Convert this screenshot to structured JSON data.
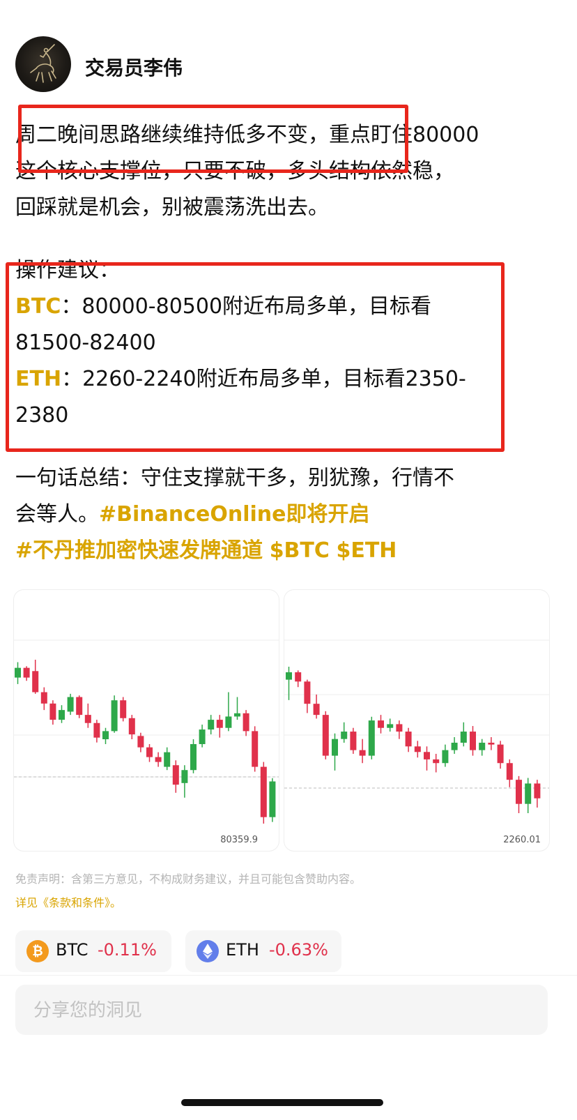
{
  "post": {
    "author": "交易员李伟",
    "para1": [
      "周二晚间思路继续维持低多不变，重点盯住80000",
      "这个核心支撑位，只要不破，多头结构依然稳，",
      "回踩就是机会，别被震荡洗出去。"
    ],
    "ops_title": "操作建议：",
    "btc_label": "BTC",
    "btc_line1": "：80000-80500附近布局多单，目标看",
    "btc_line2": "81500-82400",
    "eth_label": "ETH",
    "eth_line1": "：2260-2240附近布局多单，目标看2350-",
    "eth_line2": "2380",
    "summary_line1": "一句话总结：守住支撑就干多，别犹豫，行情不",
    "summary_line2_text": "会等人。",
    "tag1": "#BinanceOnline即将开启",
    "tag2": "#不丹推加密快速发牌通道",
    "cashtag_btc": "$BTC",
    "cashtag_eth": "$ETH"
  },
  "charts": {
    "btc_price": "80359.9",
    "eth_price": "2260.01"
  },
  "chart_data": [
    {
      "type": "candlestick",
      "price_label": "80359.9",
      "candles": [
        {
          "o": 80,
          "c": 92,
          "h": 99,
          "l": 72
        },
        {
          "o": 92,
          "c": 80,
          "h": 94,
          "l": 76
        },
        {
          "o": 88,
          "c": 62,
          "h": 102,
          "l": 60
        },
        {
          "o": 62,
          "c": 48,
          "h": 68,
          "l": 40
        },
        {
          "o": 48,
          "c": 28,
          "h": 52,
          "l": 22
        },
        {
          "o": 28,
          "c": 40,
          "h": 46,
          "l": 24
        },
        {
          "o": 38,
          "c": 56,
          "h": 60,
          "l": 34
        },
        {
          "o": 56,
          "c": 34,
          "h": 58,
          "l": 30
        },
        {
          "o": 34,
          "c": 24,
          "h": 48,
          "l": 18
        },
        {
          "o": 24,
          "c": 6,
          "h": 28,
          "l": 0
        },
        {
          "o": 4,
          "c": 14,
          "h": 18,
          "l": -2
        },
        {
          "o": 14,
          "c": 52,
          "h": 58,
          "l": 12
        },
        {
          "o": 52,
          "c": 30,
          "h": 56,
          "l": 26
        },
        {
          "o": 30,
          "c": 10,
          "h": 34,
          "l": 4
        },
        {
          "o": 8,
          "c": -6,
          "h": 12,
          "l": -12
        },
        {
          "o": -6,
          "c": -18,
          "h": -2,
          "l": -24
        },
        {
          "o": -18,
          "c": -24,
          "h": -12,
          "l": -30
        },
        {
          "o": -30,
          "c": -12,
          "h": -6,
          "l": -34
        },
        {
          "o": -28,
          "c": -52,
          "h": -22,
          "l": -62
        },
        {
          "o": -50,
          "c": -34,
          "h": -28,
          "l": -68
        },
        {
          "o": -34,
          "c": -2,
          "h": 4,
          "l": -38
        },
        {
          "o": -2,
          "c": 16,
          "h": 22,
          "l": -6
        },
        {
          "o": 16,
          "c": 28,
          "h": 34,
          "l": 10
        },
        {
          "o": 28,
          "c": 18,
          "h": 34,
          "l": 6
        },
        {
          "o": 18,
          "c": 32,
          "h": 62,
          "l": 14
        },
        {
          "o": 32,
          "c": 36,
          "h": 56,
          "l": 28
        },
        {
          "o": 36,
          "c": 14,
          "h": 40,
          "l": 8
        },
        {
          "o": 14,
          "c": -30,
          "h": 20,
          "l": -36
        },
        {
          "o": -30,
          "c": -92,
          "h": -24,
          "l": -100
        },
        {
          "o": -92,
          "c": -48,
          "h": -44,
          "l": -98
        }
      ]
    },
    {
      "type": "candlestick",
      "price_label": "2260.01",
      "candles": [
        {
          "o": 86,
          "c": 94,
          "h": 100,
          "l": 64
        },
        {
          "o": 94,
          "c": 84,
          "h": 96,
          "l": 78
        },
        {
          "o": 84,
          "c": 60,
          "h": 86,
          "l": 50
        },
        {
          "o": 60,
          "c": 48,
          "h": 70,
          "l": 44
        },
        {
          "o": 48,
          "c": 4,
          "h": 52,
          "l": 0
        },
        {
          "o": 4,
          "c": 22,
          "h": 28,
          "l": -12
        },
        {
          "o": 22,
          "c": 30,
          "h": 40,
          "l": 18
        },
        {
          "o": 30,
          "c": 10,
          "h": 34,
          "l": 6
        },
        {
          "o": 10,
          "c": 4,
          "h": 22,
          "l": -4
        },
        {
          "o": 4,
          "c": 42,
          "h": 46,
          "l": 0
        },
        {
          "o": 42,
          "c": 34,
          "h": 48,
          "l": 28
        },
        {
          "o": 34,
          "c": 38,
          "h": 44,
          "l": 30
        },
        {
          "o": 38,
          "c": 30,
          "h": 42,
          "l": 22
        },
        {
          "o": 30,
          "c": 14,
          "h": 34,
          "l": 8
        },
        {
          "o": 14,
          "c": 8,
          "h": 20,
          "l": 2
        },
        {
          "o": 8,
          "c": 0,
          "h": 14,
          "l": -12
        },
        {
          "o": 0,
          "c": -4,
          "h": 6,
          "l": -14
        },
        {
          "o": -4,
          "c": 10,
          "h": 16,
          "l": -8
        },
        {
          "o": 10,
          "c": 18,
          "h": 24,
          "l": 6
        },
        {
          "o": 18,
          "c": 30,
          "h": 40,
          "l": 14
        },
        {
          "o": 30,
          "c": 10,
          "h": 36,
          "l": 4
        },
        {
          "o": 10,
          "c": 18,
          "h": 22,
          "l": 4
        },
        {
          "o": 18,
          "c": 16,
          "h": 24,
          "l": 10
        },
        {
          "o": 16,
          "c": -4,
          "h": 20,
          "l": -10
        },
        {
          "o": -4,
          "c": -22,
          "h": 0,
          "l": -30
        },
        {
          "o": -22,
          "c": -48,
          "h": -18,
          "l": -58
        },
        {
          "o": -48,
          "c": -26,
          "h": -20,
          "l": -58
        },
        {
          "o": -26,
          "c": -42,
          "h": -22,
          "l": -52
        }
      ]
    }
  ],
  "disclaimer": {
    "text": "免责声明：含第三方意见，不构成财务建议，并且可能包含赞助内容。",
    "terms": "详见《条款和条件》。"
  },
  "coins": [
    {
      "icon": "bitcoin-icon",
      "symbol": "BTC",
      "change": "-0.11%",
      "color": "#e0314b"
    },
    {
      "icon": "ethereum-icon",
      "symbol": "ETH",
      "change": "-0.63%",
      "color": "#e0314b"
    }
  ],
  "share": {
    "placeholder": "分享您的洞见"
  },
  "colors": {
    "accent_gold": "#d9a400",
    "highlight_red": "#e8261c",
    "candle_up": "#2ea84a",
    "candle_down": "#e0314b"
  }
}
